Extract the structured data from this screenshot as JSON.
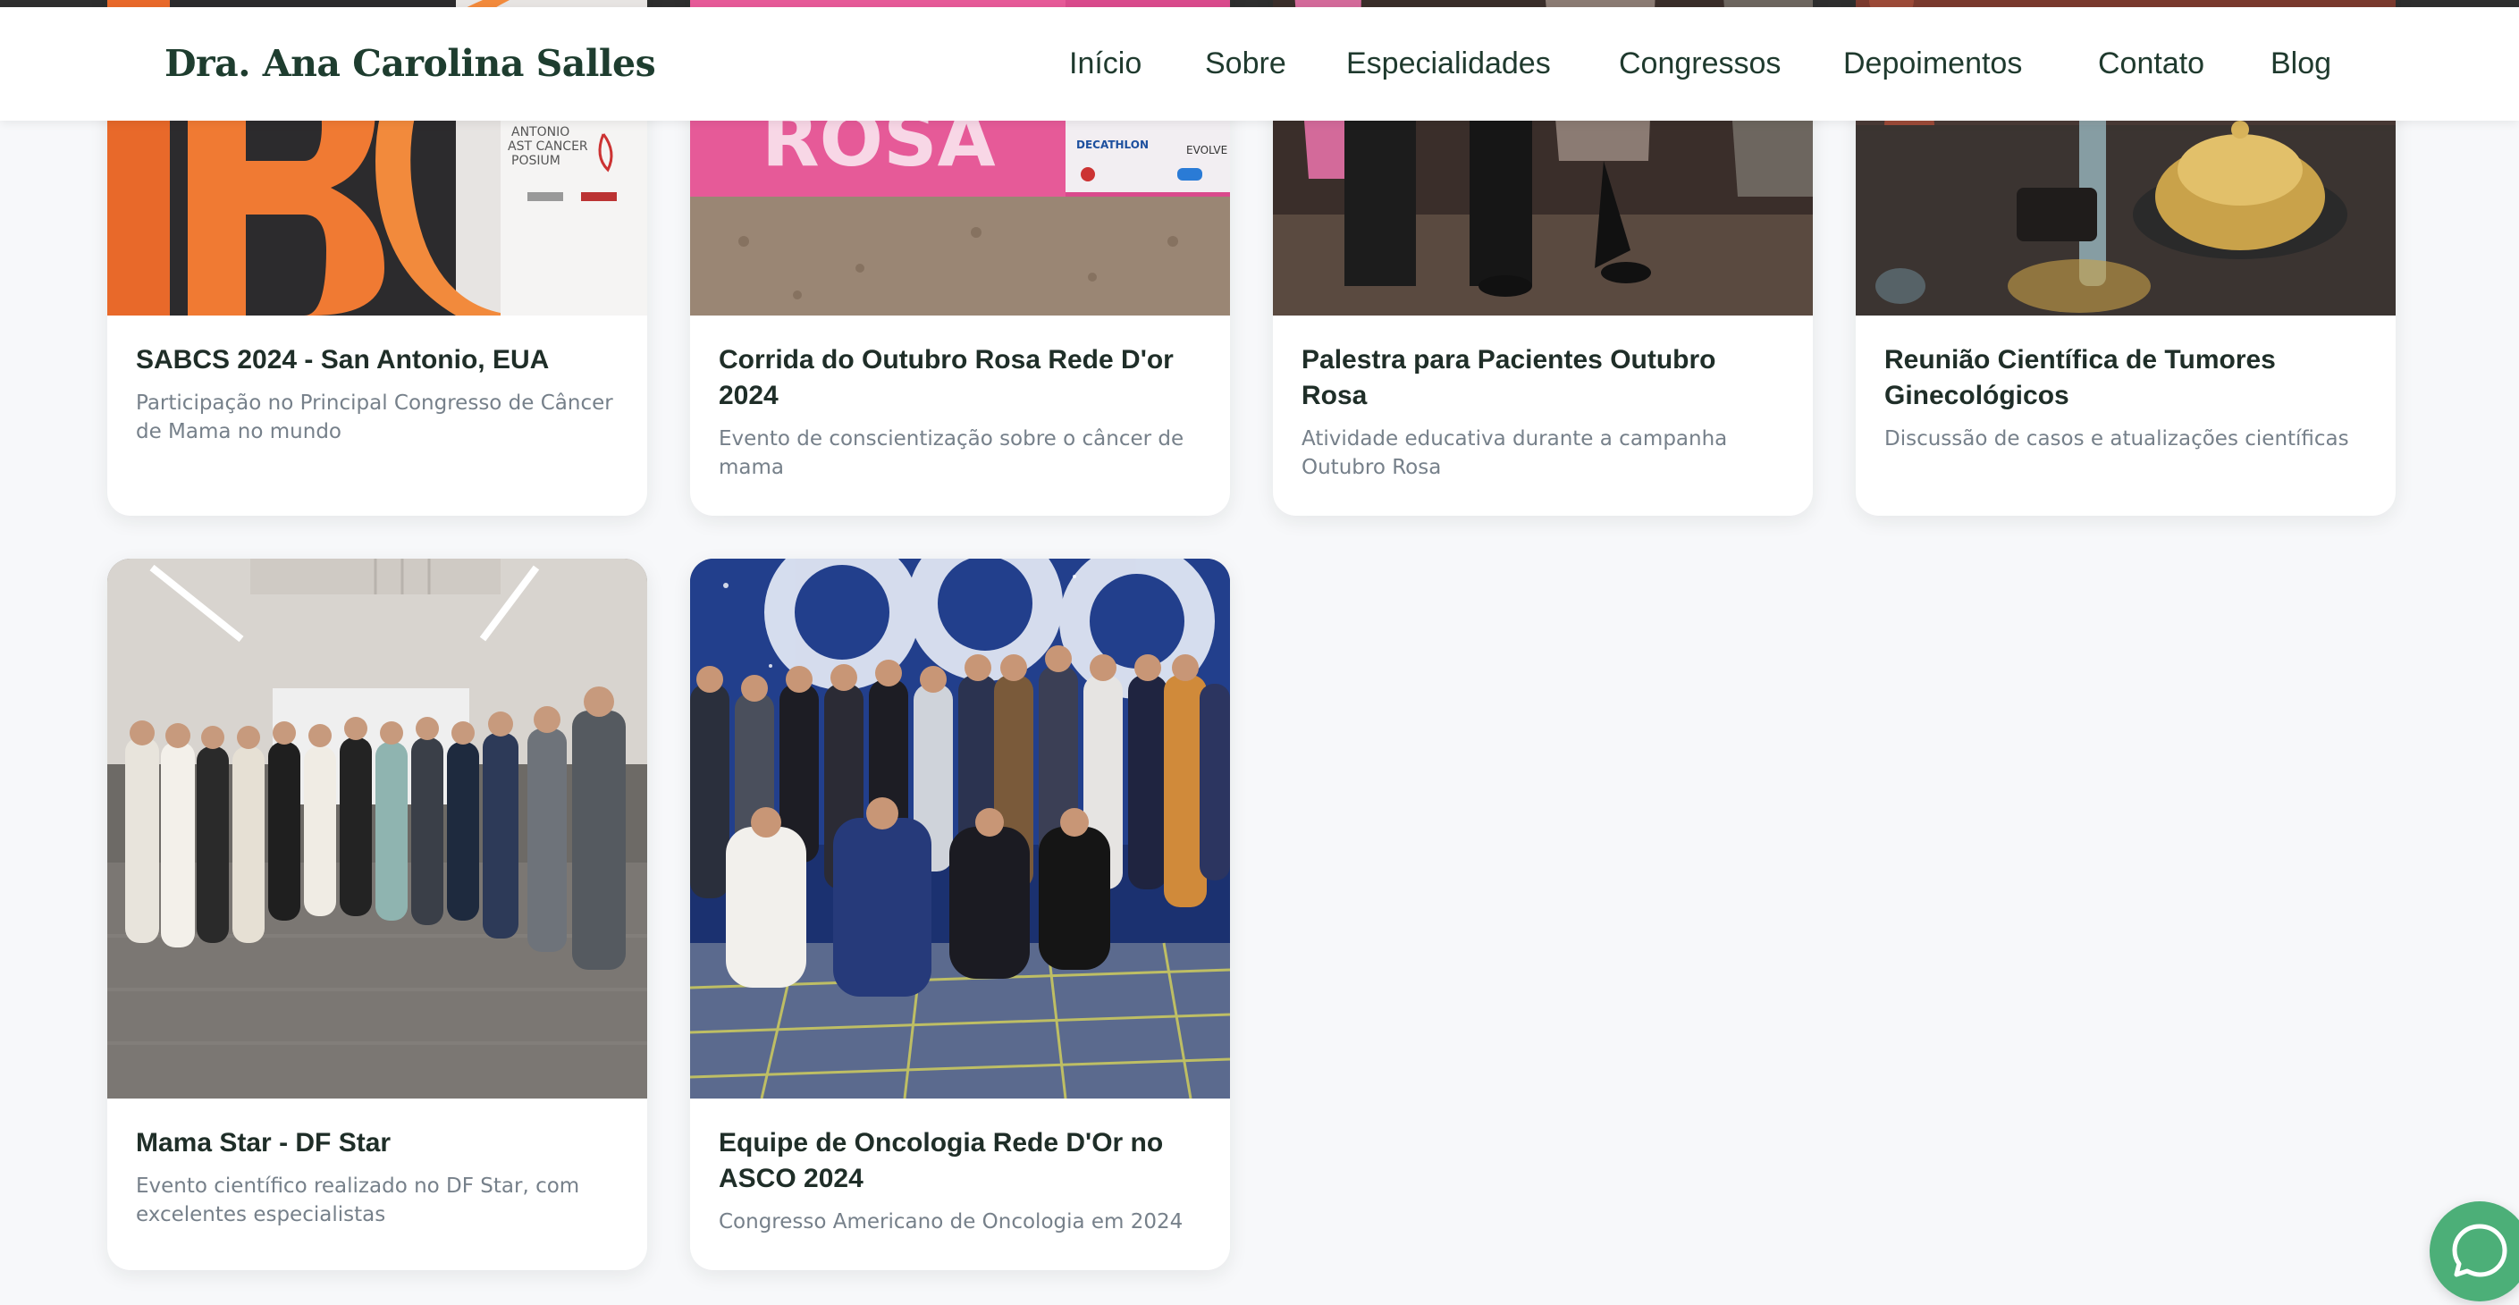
{
  "header": {
    "brand": "Dra. Ana Carolina Salles",
    "nav": [
      "Início",
      "Sobre",
      "Especialidades",
      "Congressos",
      "Depoimentos",
      "Contato",
      "Blog"
    ]
  },
  "cards": [
    {
      "title": "SABCS 2024 - San Antonio, EUA",
      "description": "Participação no Principal Congresso de Câncer de Mama no mundo",
      "image_text": [
        "ANTONIO",
        "AST CANCER",
        "POSIUM"
      ]
    },
    {
      "title": "Corrida do Outubro Rosa Rede D'or 2024",
      "description": "Evento de conscientização sobre o câncer de mama",
      "image_text": [
        "ROSA",
        "DECATHLON",
        "EVOLVE"
      ]
    },
    {
      "title": "Palestra para Pacientes Outubro Rosa",
      "description": "Atividade educativa durante a campanha Outubro Rosa"
    },
    {
      "title": "Reunião Científica de Tumores Ginecológicos",
      "description": "Discussão de casos e atualizações científicas"
    },
    {
      "title": "Mama Star - DF Star",
      "description": "Evento científico realizado no DF Star, com excelentes especialistas"
    },
    {
      "title": "Equipe de Oncologia Rede D'Or no ASCO 2024",
      "description": "Congresso Americano de Oncologia em 2024"
    }
  ],
  "colors": {
    "brand": "#1e3d2f",
    "background": "#f7f8fa",
    "whatsapp": "#4caf78"
  },
  "icons": {
    "chat": "chat-bubble-icon"
  }
}
